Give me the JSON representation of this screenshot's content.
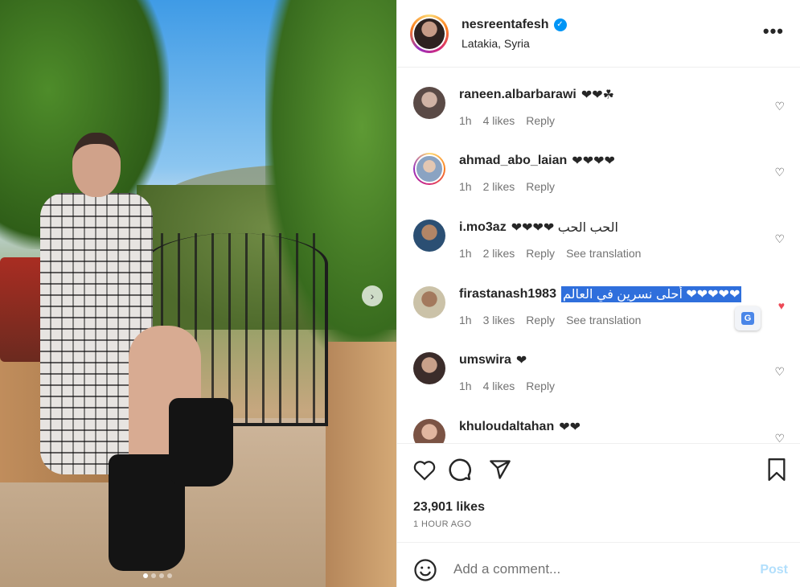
{
  "owner": {
    "username": "nesreentafesh",
    "location": "Latakia, Syria",
    "verified_glyph": "✓"
  },
  "more_glyph": "•••",
  "carousel": {
    "current_slide": 1,
    "total_slides": 4,
    "next_glyph": "›"
  },
  "comments": [
    {
      "username": "raneen.albarbarawi",
      "text": "❤❤☘",
      "time": "1h",
      "likes": "4 likes",
      "reply": "Reply",
      "translation": "",
      "liked": false,
      "avatar_ring": false
    },
    {
      "username": "ahmad_abo_laian",
      "text": "❤❤❤❤",
      "time": "1h",
      "likes": "2 likes",
      "reply": "Reply",
      "translation": "",
      "liked": false,
      "avatar_ring": true
    },
    {
      "username": "i.mo3az",
      "text": "❤❤❤❤ الحب الحب",
      "time": "1h",
      "likes": "2 likes",
      "reply": "Reply",
      "translation": "See translation",
      "liked": false,
      "avatar_ring": false
    },
    {
      "username": "firastanash1983",
      "text": "أحلى نسرين في العالم ❤❤❤❤❤",
      "time": "1h",
      "likes": "3 likes",
      "reply": "Reply",
      "translation": "See translation",
      "liked": true,
      "avatar_ring": false,
      "highlighted": true
    },
    {
      "username": "umswira",
      "text": "❤",
      "time": "1h",
      "likes": "4 likes",
      "reply": "Reply",
      "translation": "",
      "liked": false,
      "avatar_ring": false
    },
    {
      "username": "khuloudaltahan",
      "text": "❤❤",
      "time": "",
      "likes": "",
      "reply": "",
      "translation": "",
      "liked": false,
      "avatar_ring": false
    }
  ],
  "heart_glyph": "♡",
  "liked_heart_glyph": "♥",
  "translate_popup_glyph": "G",
  "post": {
    "likes": "23,901 likes",
    "time_ago": "1 HOUR AGO"
  },
  "comment_box": {
    "placeholder": "Add a comment...",
    "post_label": "Post"
  },
  "icons": {
    "like": "heart-icon",
    "comment": "comment-icon",
    "share": "paper-plane-icon",
    "save": "bookmark-icon",
    "emoji": "smiley-icon"
  },
  "colors": {
    "verified": "#0095f6",
    "liked": "#ed4956",
    "post_button": "#b2dffc",
    "highlight": "#2f6fdc"
  }
}
